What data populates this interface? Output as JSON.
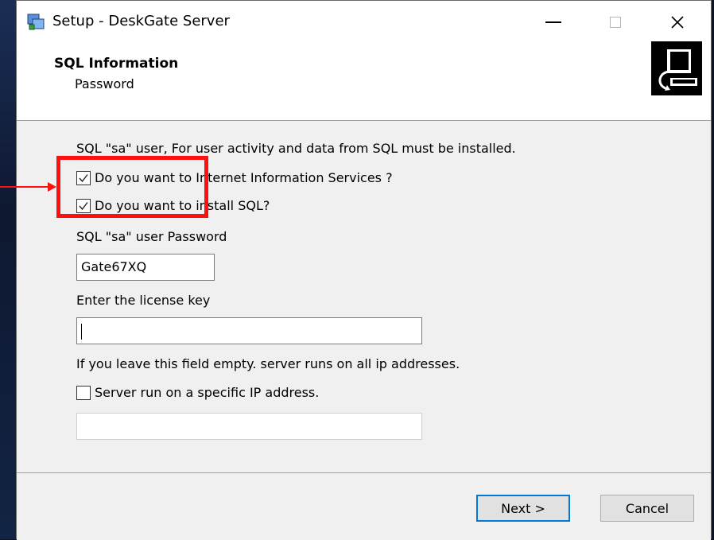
{
  "window": {
    "title": "Setup - DeskGate Server",
    "icon": "setup-app-icon"
  },
  "header": {
    "title": "SQL Information",
    "subtitle": "Password"
  },
  "body": {
    "description": "SQL \"sa\" user, For user activity and data from SQL must be installed.",
    "checkboxes": [
      {
        "label": "Do you want to Internet Information Services ?",
        "checked": true
      },
      {
        "label": "Do you want to install SQL?",
        "checked": true
      }
    ],
    "password_label": "SQL \"sa\" user Password",
    "password_value": "Gate67XQ",
    "license_label": "Enter the license key",
    "license_value": "",
    "ip_note": "If you leave this field empty. server runs on all ip addresses.",
    "ip_checkbox": {
      "label": "Server run on a specific IP address.",
      "checked": false
    },
    "ip_value": ""
  },
  "footer": {
    "next_label": "Next >",
    "cancel_label": "Cancel"
  },
  "colors": {
    "annotation": "#ff1010",
    "default_button_border": "#0078d7",
    "body_background": "#f0f0f0"
  }
}
